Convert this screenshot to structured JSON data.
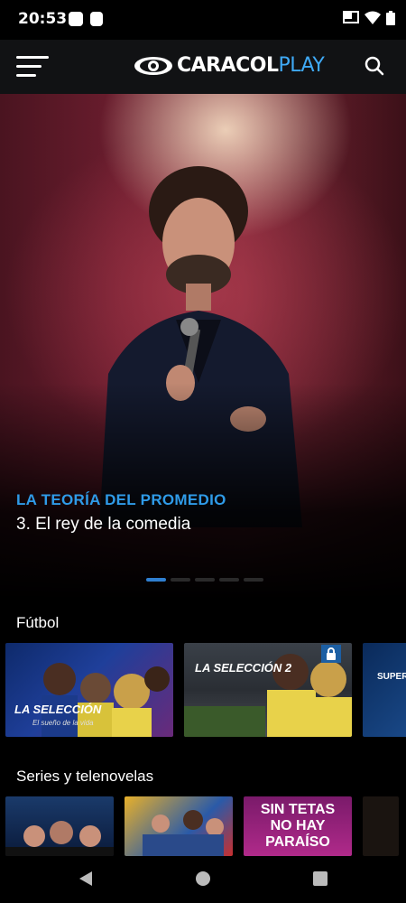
{
  "status": {
    "time": "20:53"
  },
  "header": {
    "logo_main": "CARACOL",
    "logo_accent": "PLAY"
  },
  "hero": {
    "category": "LA TEORÍA DEL PROMEDIO",
    "title": "3. El rey de la comedia"
  },
  "sections": [
    {
      "title": "Fútbol",
      "cards": [
        {
          "overlay": "LA SELECCIÓN",
          "sub": "El sueño de la vida"
        },
        {
          "overlay": "LA SELECCIÓN 2",
          "locked": true
        },
        {
          "overlay": "SUPERPO"
        }
      ]
    },
    {
      "title": "Series y telenovelas",
      "cards": [
        {
          "overlay": ""
        },
        {
          "overlay": ""
        },
        {
          "overlay": "SIN TETAS NO HAY PARAÍSO"
        },
        {
          "overlay": ""
        }
      ]
    }
  ],
  "colors": {
    "accent": "#2f9be8",
    "bg": "#000000",
    "topbar": "#111214"
  }
}
